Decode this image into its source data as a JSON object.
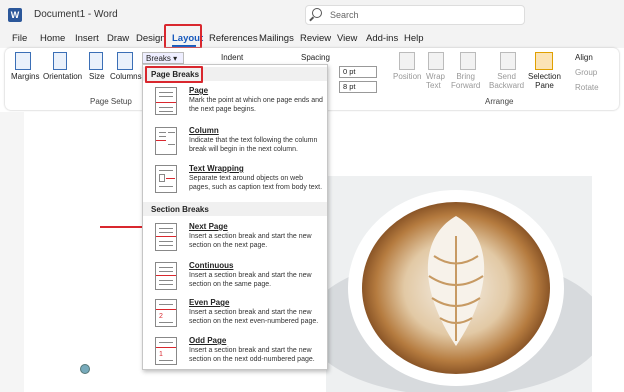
{
  "titlebar": {
    "app_title": "Document1 - Word",
    "search_placeholder": "Search"
  },
  "tabs": [
    "File",
    "Home",
    "Insert",
    "Draw",
    "Design",
    "Layout",
    "References",
    "Mailings",
    "Review",
    "View",
    "Add-ins",
    "Help"
  ],
  "active_tab": "Layout",
  "ribbon": {
    "margins": "Margins",
    "orientation": "Orientation",
    "size": "Size",
    "columns": "Columns",
    "page_setup": "Page Setup",
    "breaks": "Breaks",
    "indent": "Indent",
    "spacing": "Spacing",
    "before_value": "0 pt",
    "after_value": "8 pt",
    "position": "Position",
    "wrap_text": "Wrap\nText",
    "bring_forward": "Bring\nForward",
    "send_backward": "Send\nBackward",
    "selection_pane": "Selection\nPane",
    "align": "Align",
    "group": "Group",
    "rotate": "Rotate",
    "arrange": "Arrange"
  },
  "dropdown": {
    "page_breaks_header": "Page Breaks",
    "section_breaks_header": "Section Breaks",
    "items": [
      {
        "title": "Page",
        "desc": "Mark the point at which one page ends and the next page begins."
      },
      {
        "title": "Column",
        "desc": "Indicate that the text following the column break will begin in the next column."
      },
      {
        "title": "Text Wrapping",
        "desc": "Separate text around objects on web pages, such as caption text from body text."
      },
      {
        "title": "Next Page",
        "desc": "Insert a section break and start the new section on the next page."
      },
      {
        "title": "Continuous",
        "desc": "Insert a section break and start the new section on the same page."
      },
      {
        "title": "Even Page",
        "desc": "Insert a section break and start the new section on the next even-numbered page."
      },
      {
        "title": "Odd Page",
        "desc": "Insert a section break and start the new section on the next odd-numbered page."
      }
    ]
  },
  "colors": {
    "accent": "#185abd",
    "highlight_red": "#d9272e",
    "word_blue": "#2b579a"
  }
}
